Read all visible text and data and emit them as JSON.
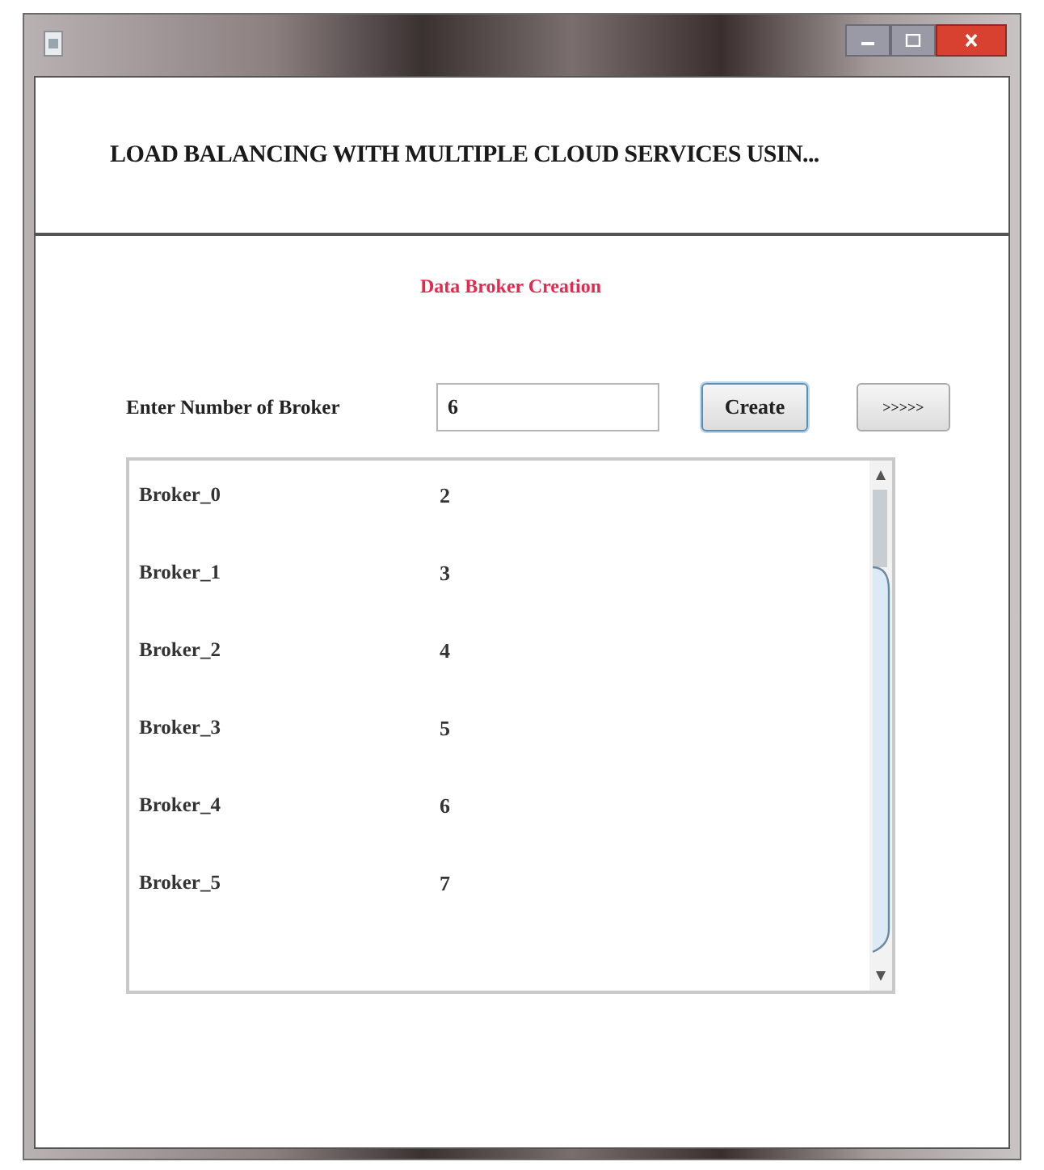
{
  "window": {
    "title": "LOAD BALANCING WITH MULTIPLE CLOUD SERVICES USIN..."
  },
  "section_title": "Data Broker Creation",
  "broker_count": {
    "label": "Enter Number of Broker",
    "value": "6"
  },
  "buttons": [
    {
      "label": "Create",
      "focused": true
    },
    {
      "label": ">>>>>",
      "focused": false
    }
  ],
  "brokers": [
    {
      "name": "Broker_0",
      "value": "2"
    },
    {
      "name": "Broker_1",
      "value": "3"
    },
    {
      "name": "Broker_2",
      "value": "4"
    },
    {
      "name": "Broker_3",
      "value": "5"
    },
    {
      "name": "Broker_4",
      "value": "6"
    },
    {
      "name": "Broker_5",
      "value": "7"
    }
  ]
}
